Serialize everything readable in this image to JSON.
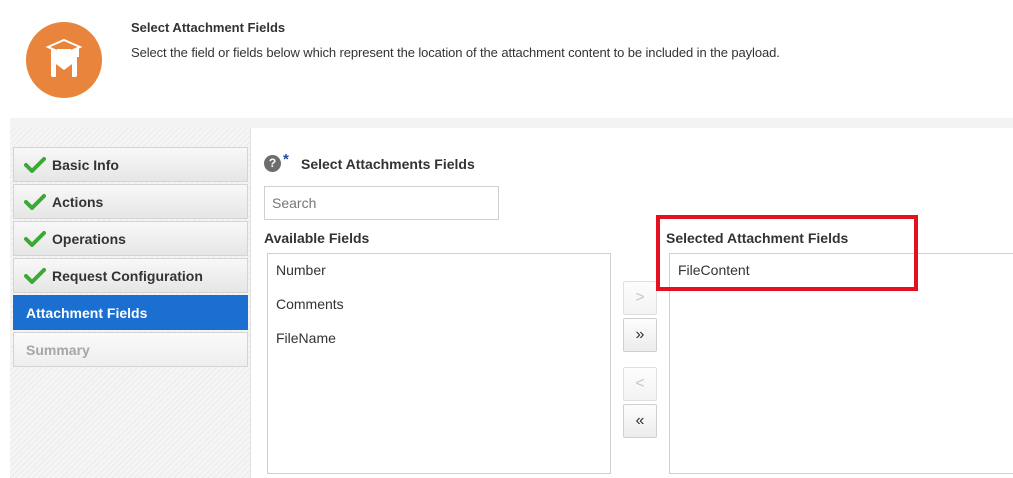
{
  "header": {
    "title": "Select Attachment Fields",
    "description": "Select the field or fields below which represent the location of the attachment content to be included in the payload.",
    "icon": "graduate-icon",
    "icon_color": "#e8843c"
  },
  "train": {
    "items": [
      {
        "label": "Basic Info",
        "state": "complete"
      },
      {
        "label": "Actions",
        "state": "complete"
      },
      {
        "label": "Operations",
        "state": "complete"
      },
      {
        "label": "Request Configuration",
        "state": "complete"
      },
      {
        "label": "Attachment Fields",
        "state": "active"
      },
      {
        "label": "Summary",
        "state": "disabled"
      }
    ],
    "active_color": "#1a6fd0",
    "check_color": "#3aa935"
  },
  "main": {
    "required_marker": "*",
    "section_label": "Select Attachments Fields",
    "search_placeholder": "Search",
    "available_header": "Available Fields",
    "selected_header": "Selected Attachment Fields",
    "available_fields": [
      "Number",
      "Comments",
      "FileName"
    ],
    "selected_fields": [
      "FileContent"
    ],
    "buttons": {
      "move": ">",
      "move_all": "»",
      "remove": "<",
      "remove_all": "«"
    },
    "highlight_color": "#e3101f"
  }
}
